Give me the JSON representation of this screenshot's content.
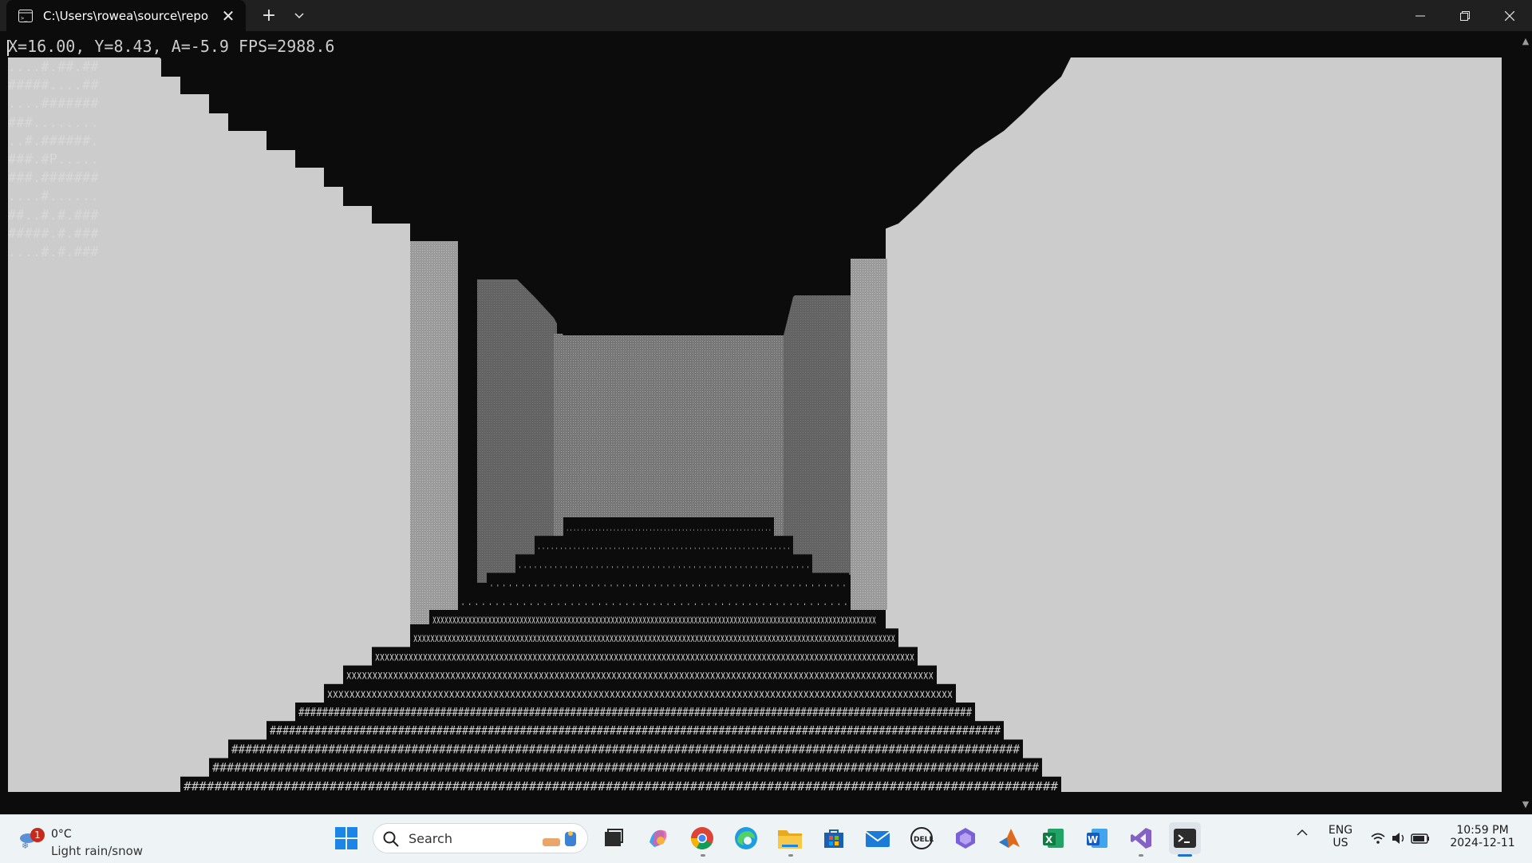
{
  "window": {
    "tab_title": "C:\\Users\\rowea\\source\\repos\\",
    "new_tab_glyph": "+",
    "close_tab_glyph": "✕"
  },
  "terminal": {
    "status_line": "X=16.00, Y=8.43, A=-5.9 FPS=2988.6",
    "minimap_rows": [
      "....#.##.##",
      "#####....##",
      "....#######",
      "###........",
      "..#.######.",
      "###.#P.....",
      "###.#######",
      "....#......",
      "##..#.#.###",
      "#####.#.###",
      "....#.#.###"
    ],
    "floor_rows": [
      ". . . . . . . . . . . . . . . . . . . . . . . . . . . . . . . . . . . . . . . . . . . . . . . . . . . . . . . . .",
      ". . . . . . . . . . . . . . . . . . . . . . . . . . . . . . . . . . . . . . . . . . . . . . . . . . . . . . . . .",
      ". . . . . . . . . . . . . . . . . . . . . . . . . . . . . . . . . . . . . . . . . . . . . . . . . . . . . . . . .",
      ". . . . . . . . . . . . . . . . . . . . . . . . . . . . . . . . . . . . . . . . . . . . . . . . . . . . . . . . .",
      ". . . . . . . . . . . . . . . . . . . . . . . . . . . . . . . . . . . . . . . . . . . . . . . . . . . . . . . . .",
      "xxxxxxxxxxxxxxxxxxxxxxxxxxxxxxxxxxxxxxxxxxxxxxxxxxxxxxxxxxxxxxxxxxxxxxxxxxxxxxxxxxxxxxxxxxxxxxxxxxxxxxxxxxxxxxxx",
      "xxxxxxxxxxxxxxxxxxxxxxxxxxxxxxxxxxxxxxxxxxxxxxxxxxxxxxxxxxxxxxxxxxxxxxxxxxxxxxxxxxxxxxxxxxxxxxxxxxxxxxxxxxxxxxxxx",
      "xxxxxxxxxxxxxxxxxxxxxxxxxxxxxxxxxxxxxxxxxxxxxxxxxxxxxxxxxxxxxxxxxxxxxxxxxxxxxxxxxxxxxxxxxxxxxxxxxxxxxxxxxxxxxxxxx",
      "xxxxxxxxxxxxxxxxxxxxxxxxxxxxxxxxxxxxxxxxxxxxxxxxxxxxxxxxxxxxxxxxxxxxxxxxxxxxxxxxxxxxxxxxxxxxxxxxxxxxxxxxxxxxxxxxx",
      "xxxxxxxxxxxxxxxxxxxxxxxxxxxxxxxxxxxxxxxxxxxxxxxxxxxxxxxxxxxxxxxxxxxxxxxxxxxxxxxxxxxxxxxxxxxxxxxxxxxxxxxxxxxxxxxxx",
      "##################################################################################################################",
      "##################################################################################################################",
      "##################################################################################################################",
      "##################################################################################################################",
      "##################################################################################################################"
    ],
    "colors": {
      "background": "#0c0c0c",
      "wall_near": "#cccccc",
      "wall_mid": "#9b9b9b",
      "wall_dark": "#6a6a6a",
      "wall_far": "#888888",
      "text": "#cccccc"
    }
  },
  "taskbar": {
    "weather": {
      "temp": "0°C",
      "description": "Light rain/snow",
      "badge": "1"
    },
    "search_placeholder": "Search",
    "apps": [
      {
        "name": "start-icon"
      },
      {
        "name": "task-view-icon"
      },
      {
        "name": "copilot-icon"
      },
      {
        "name": "chrome-icon"
      },
      {
        "name": "edge-icon"
      },
      {
        "name": "file-explorer-icon"
      },
      {
        "name": "store-icon"
      },
      {
        "name": "mail-icon"
      },
      {
        "name": "dell-icon"
      },
      {
        "name": "app-icon"
      },
      {
        "name": "matlab-icon"
      },
      {
        "name": "excel-icon"
      },
      {
        "name": "word-icon"
      },
      {
        "name": "visual-studio-icon"
      },
      {
        "name": "terminal-icon"
      }
    ],
    "tray": {
      "lang_top": "ENG",
      "lang_bottom": "US",
      "time": "10:59 PM",
      "date": "2024-12-11"
    }
  }
}
